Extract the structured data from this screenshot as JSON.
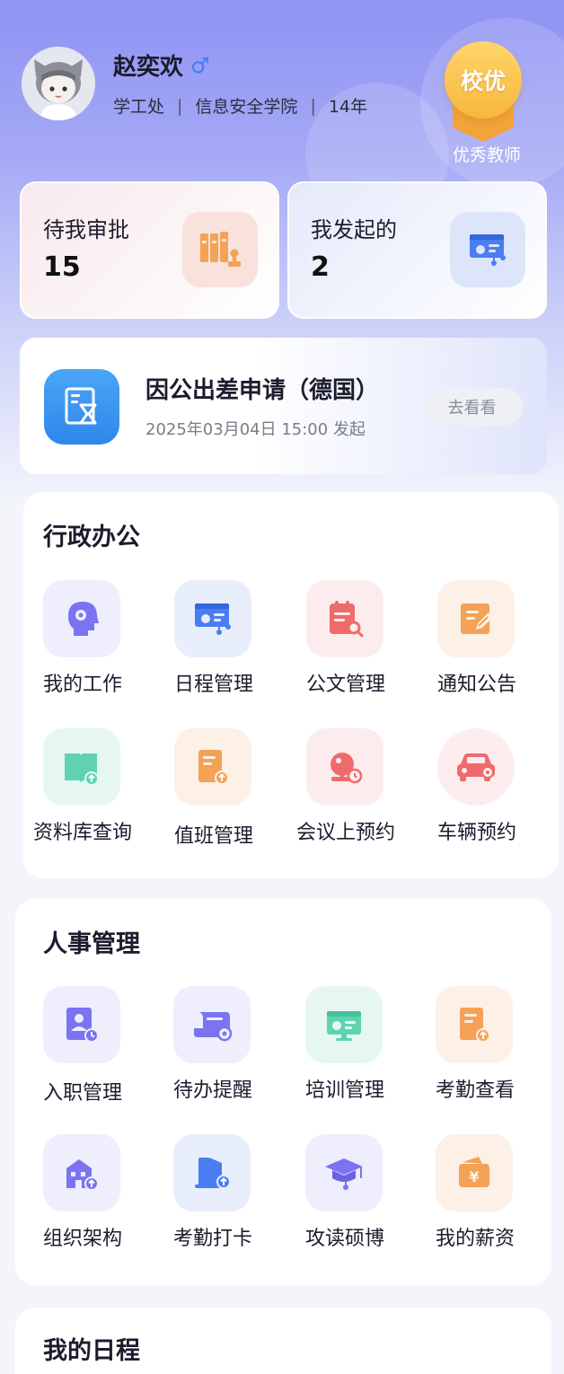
{
  "profile": {
    "name": "赵奕欢",
    "gender_symbol": "♂",
    "department": "学工处",
    "college": "信息安全学院",
    "years": "14年",
    "badge_text": "校优",
    "badge_label": "优秀教师"
  },
  "stats": {
    "pending_label": "待我审批",
    "pending_count": "15",
    "initiated_label": "我发起的",
    "initiated_count": "2"
  },
  "trip": {
    "title": "因公出差申请（德国）",
    "time": "2025年03月04日  15:00  发起",
    "button": "去看看"
  },
  "admin": {
    "title": "行政办公",
    "items": [
      {
        "label": "我的工作",
        "icon": "head-profile-icon"
      },
      {
        "label": "日程管理",
        "icon": "schedule-board-icon"
      },
      {
        "label": "公文管理",
        "icon": "document-search-icon"
      },
      {
        "label": "通知公告",
        "icon": "edit-note-icon"
      },
      {
        "label": "资料库查询",
        "icon": "book-upload-icon"
      },
      {
        "label": "值班管理",
        "icon": "duty-doc-icon"
      },
      {
        "label": "会议上预约",
        "icon": "meeting-bell-icon"
      },
      {
        "label": "车辆预约",
        "icon": "car-icon"
      }
    ]
  },
  "hr": {
    "title": "人事管理",
    "items": [
      {
        "label": "入职管理",
        "icon": "onboard-clock-icon"
      },
      {
        "label": "待办提醒",
        "icon": "scroll-eye-icon"
      },
      {
        "label": "培训管理",
        "icon": "training-board-icon"
      },
      {
        "label": "考勤查看",
        "icon": "attendance-doc-icon"
      },
      {
        "label": "组织架构",
        "icon": "building-icon"
      },
      {
        "label": "考勤打卡",
        "icon": "clock-in-icon"
      },
      {
        "label": "攻读硕博",
        "icon": "graduation-cap-icon"
      },
      {
        "label": "我的薪资",
        "icon": "wallet-icon"
      }
    ]
  },
  "schedule": {
    "title": "我的日程"
  },
  "colors": {
    "accent_purple": "#7b73f0",
    "accent_orange": "#f3a256",
    "accent_red": "#ef6b6b",
    "accent_blue": "#3d7ef5",
    "accent_green": "#5fd3b0"
  }
}
